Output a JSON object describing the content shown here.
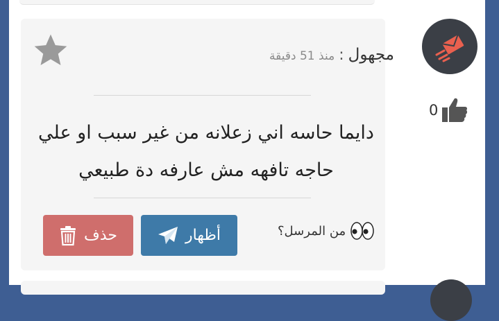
{
  "message": {
    "sender": "مجهول",
    "separator": ":",
    "time": "منذ 51 دقيقة",
    "text": "دايما حاسه اني زعلانه من غير سبب او علي حاجه تافهه مش عارفه دة طبيعي",
    "likes": "0"
  },
  "actions": {
    "show_label": "أظهار",
    "delete_label": "حذف",
    "who_sent": "من المرسل؟"
  },
  "icons": {
    "star": "star-icon",
    "avatar": "envelope-icon",
    "like": "thumbs-up-icon",
    "send": "paper-plane-icon",
    "delete": "trash-icon",
    "eyes": "eyes-icon"
  },
  "colors": {
    "delete_button": "#cf6e6c",
    "show_button": "#3e7aa8",
    "card_background": "#f5f5f5",
    "page_background": "#3e5e93",
    "avatar_background": "#3b3f46",
    "avatar_accent": "#e9604f"
  }
}
